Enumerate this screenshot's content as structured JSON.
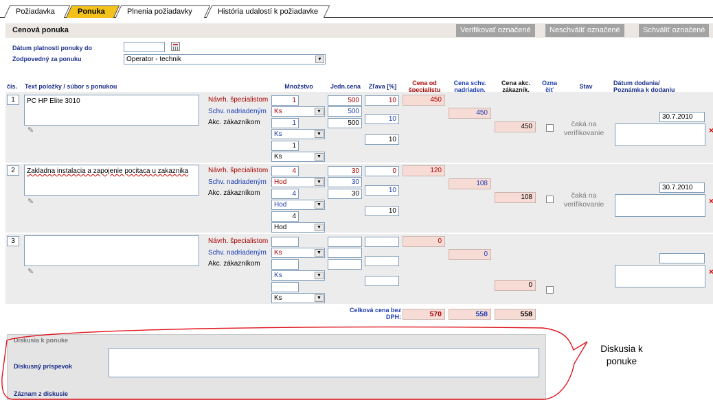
{
  "tabs": [
    "Požiadavka",
    "Ponuka",
    "Plnenia požiadavky",
    "História udalostí k požiadavke"
  ],
  "section_title": "Cenová ponuka",
  "buttons": {
    "verify": "Verifikovať označené",
    "reject": "Neschváliť označené",
    "approve": "Schváliť označené"
  },
  "form": {
    "validity_label": "Dátum platnosti ponuky do",
    "responsible_label": "Zodpovedný za ponuku",
    "responsible_value": "Operator - technik"
  },
  "columns": {
    "num": "čís.",
    "text": "Text položky / súbor s ponukou",
    "qty": "Množstvo",
    "unit_price": "Jedn.cena",
    "discount": "Zľava [%]",
    "price_spec": "Cena od špecialistu",
    "price_appr": "Cena schv. nadriaden.",
    "price_cust": "Cena akc. zákazník.",
    "mark": "Ozna čiť",
    "status": "Stav",
    "delivery": "Dátum dodania/ Poznámka k dodaniu"
  },
  "row_labels": {
    "spec": "Návrh. špecialistom",
    "appr": "Schv. nadriadeným",
    "cust": "Akc. zákazníkom"
  },
  "rows": [
    {
      "num": "1",
      "text": "PC HP Elite 3010",
      "q1": "1",
      "u1": "Ks",
      "q2": "1",
      "u2": "Ks",
      "q3": "1",
      "u3": "Ks",
      "p1": "500",
      "p2": "500",
      "p3": "500",
      "d1": "10",
      "d2": "10",
      "d3": "10",
      "spec": "450",
      "appr": "450",
      "cust": "450",
      "status": "čaká na verifikovanie",
      "date": "30.7.2010"
    },
    {
      "num": "2",
      "text": "Zakladna instalacia a zapojenie pocitaca u zakaznika",
      "q1": "4",
      "u1": "Hod",
      "q2": "4",
      "u2": "Hod",
      "q3": "4",
      "u3": "Hod",
      "p1": "30",
      "p2": "30",
      "p3": "30",
      "d1": "0",
      "d2": "10",
      "d3": "10",
      "spec": "120",
      "appr": "108",
      "cust": "108",
      "status": "čaká na verifikovanie",
      "date": "30.7.2010"
    },
    {
      "num": "3",
      "text": "",
      "q1": "",
      "u1": "Ks",
      "q2": "",
      "u2": "Ks",
      "q3": "",
      "u3": "Ks",
      "p1": "",
      "p2": "",
      "p3": "",
      "d1": "",
      "d2": "",
      "d3": "",
      "spec": "0",
      "appr": "0",
      "cust": "0",
      "status": "",
      "date": ""
    }
  ],
  "totals": {
    "label": "Celková cena bez DPH:",
    "spec": "570",
    "appr": "558",
    "cust": "558"
  },
  "discussion": {
    "title": "Diskusia k ponuke",
    "post_label": "Diskusný príspevok",
    "record_label": "Záznam z diskusie",
    "annotation": "Diskusia k ponuke"
  }
}
